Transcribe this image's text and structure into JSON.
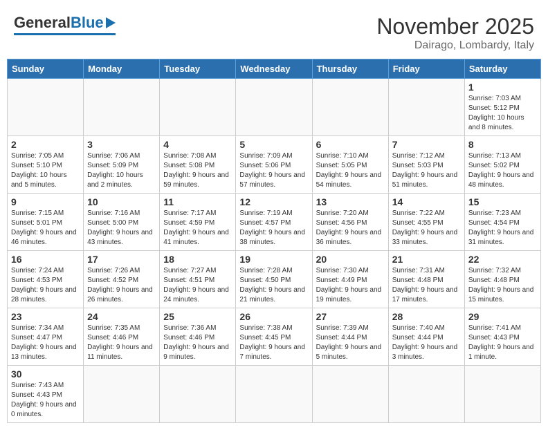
{
  "header": {
    "logo_general": "General",
    "logo_blue": "Blue",
    "month_title": "November 2025",
    "location": "Dairago, Lombardy, Italy"
  },
  "days_of_week": [
    "Sunday",
    "Monday",
    "Tuesday",
    "Wednesday",
    "Thursday",
    "Friday",
    "Saturday"
  ],
  "weeks": [
    {
      "days": [
        {
          "num": "",
          "info": ""
        },
        {
          "num": "",
          "info": ""
        },
        {
          "num": "",
          "info": ""
        },
        {
          "num": "",
          "info": ""
        },
        {
          "num": "",
          "info": ""
        },
        {
          "num": "",
          "info": ""
        },
        {
          "num": "1",
          "info": "Sunrise: 7:03 AM\nSunset: 5:12 PM\nDaylight: 10 hours and 8 minutes."
        }
      ]
    },
    {
      "days": [
        {
          "num": "2",
          "info": "Sunrise: 7:05 AM\nSunset: 5:10 PM\nDaylight: 10 hours and 5 minutes."
        },
        {
          "num": "3",
          "info": "Sunrise: 7:06 AM\nSunset: 5:09 PM\nDaylight: 10 hours and 2 minutes."
        },
        {
          "num": "4",
          "info": "Sunrise: 7:08 AM\nSunset: 5:08 PM\nDaylight: 9 hours and 59 minutes."
        },
        {
          "num": "5",
          "info": "Sunrise: 7:09 AM\nSunset: 5:06 PM\nDaylight: 9 hours and 57 minutes."
        },
        {
          "num": "6",
          "info": "Sunrise: 7:10 AM\nSunset: 5:05 PM\nDaylight: 9 hours and 54 minutes."
        },
        {
          "num": "7",
          "info": "Sunrise: 7:12 AM\nSunset: 5:03 PM\nDaylight: 9 hours and 51 minutes."
        },
        {
          "num": "8",
          "info": "Sunrise: 7:13 AM\nSunset: 5:02 PM\nDaylight: 9 hours and 48 minutes."
        }
      ]
    },
    {
      "days": [
        {
          "num": "9",
          "info": "Sunrise: 7:15 AM\nSunset: 5:01 PM\nDaylight: 9 hours and 46 minutes."
        },
        {
          "num": "10",
          "info": "Sunrise: 7:16 AM\nSunset: 5:00 PM\nDaylight: 9 hours and 43 minutes."
        },
        {
          "num": "11",
          "info": "Sunrise: 7:17 AM\nSunset: 4:59 PM\nDaylight: 9 hours and 41 minutes."
        },
        {
          "num": "12",
          "info": "Sunrise: 7:19 AM\nSunset: 4:57 PM\nDaylight: 9 hours and 38 minutes."
        },
        {
          "num": "13",
          "info": "Sunrise: 7:20 AM\nSunset: 4:56 PM\nDaylight: 9 hours and 36 minutes."
        },
        {
          "num": "14",
          "info": "Sunrise: 7:22 AM\nSunset: 4:55 PM\nDaylight: 9 hours and 33 minutes."
        },
        {
          "num": "15",
          "info": "Sunrise: 7:23 AM\nSunset: 4:54 PM\nDaylight: 9 hours and 31 minutes."
        }
      ]
    },
    {
      "days": [
        {
          "num": "16",
          "info": "Sunrise: 7:24 AM\nSunset: 4:53 PM\nDaylight: 9 hours and 28 minutes."
        },
        {
          "num": "17",
          "info": "Sunrise: 7:26 AM\nSunset: 4:52 PM\nDaylight: 9 hours and 26 minutes."
        },
        {
          "num": "18",
          "info": "Sunrise: 7:27 AM\nSunset: 4:51 PM\nDaylight: 9 hours and 24 minutes."
        },
        {
          "num": "19",
          "info": "Sunrise: 7:28 AM\nSunset: 4:50 PM\nDaylight: 9 hours and 21 minutes."
        },
        {
          "num": "20",
          "info": "Sunrise: 7:30 AM\nSunset: 4:49 PM\nDaylight: 9 hours and 19 minutes."
        },
        {
          "num": "21",
          "info": "Sunrise: 7:31 AM\nSunset: 4:48 PM\nDaylight: 9 hours and 17 minutes."
        },
        {
          "num": "22",
          "info": "Sunrise: 7:32 AM\nSunset: 4:48 PM\nDaylight: 9 hours and 15 minutes."
        }
      ]
    },
    {
      "days": [
        {
          "num": "23",
          "info": "Sunrise: 7:34 AM\nSunset: 4:47 PM\nDaylight: 9 hours and 13 minutes."
        },
        {
          "num": "24",
          "info": "Sunrise: 7:35 AM\nSunset: 4:46 PM\nDaylight: 9 hours and 11 minutes."
        },
        {
          "num": "25",
          "info": "Sunrise: 7:36 AM\nSunset: 4:46 PM\nDaylight: 9 hours and 9 minutes."
        },
        {
          "num": "26",
          "info": "Sunrise: 7:38 AM\nSunset: 4:45 PM\nDaylight: 9 hours and 7 minutes."
        },
        {
          "num": "27",
          "info": "Sunrise: 7:39 AM\nSunset: 4:44 PM\nDaylight: 9 hours and 5 minutes."
        },
        {
          "num": "28",
          "info": "Sunrise: 7:40 AM\nSunset: 4:44 PM\nDaylight: 9 hours and 3 minutes."
        },
        {
          "num": "29",
          "info": "Sunrise: 7:41 AM\nSunset: 4:43 PM\nDaylight: 9 hours and 1 minute."
        }
      ]
    },
    {
      "days": [
        {
          "num": "30",
          "info": "Sunrise: 7:43 AM\nSunset: 4:43 PM\nDaylight: 9 hours and 0 minutes."
        },
        {
          "num": "",
          "info": ""
        },
        {
          "num": "",
          "info": ""
        },
        {
          "num": "",
          "info": ""
        },
        {
          "num": "",
          "info": ""
        },
        {
          "num": "",
          "info": ""
        },
        {
          "num": "",
          "info": ""
        }
      ]
    }
  ]
}
